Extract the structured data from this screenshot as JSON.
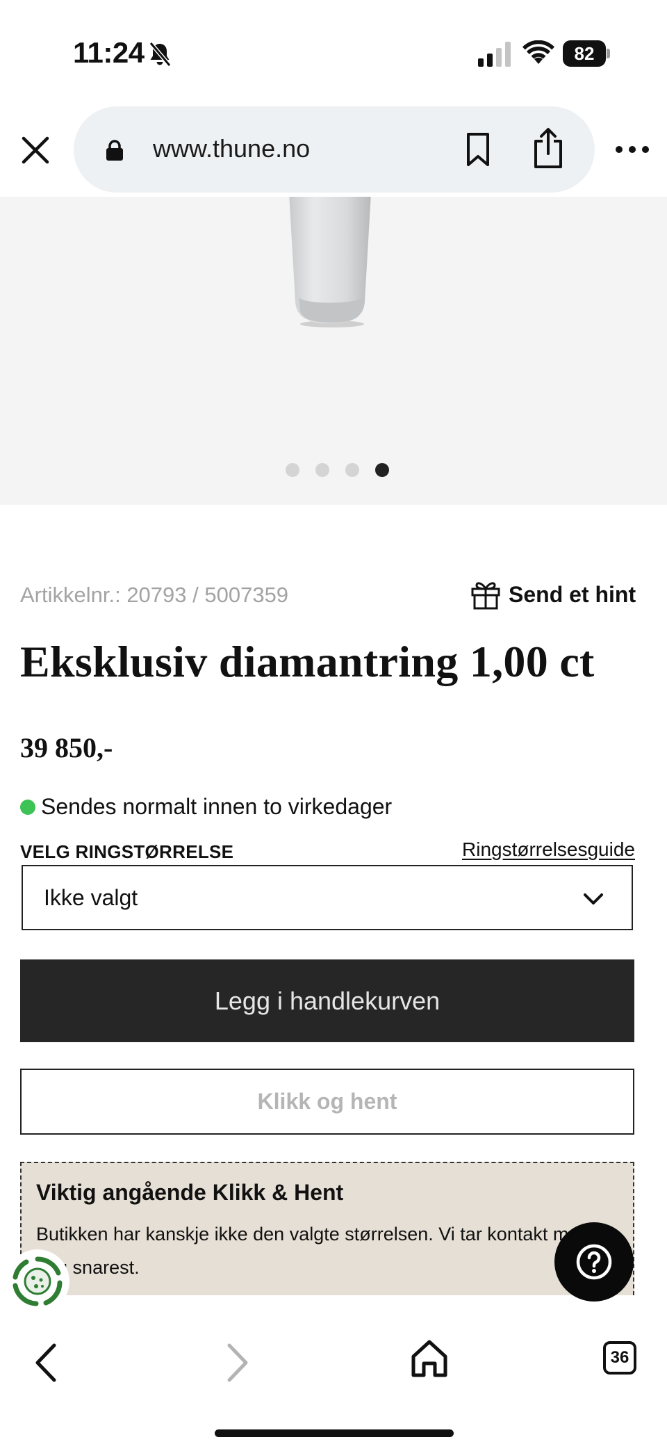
{
  "status_bar": {
    "time": "11:24",
    "battery": "82",
    "icons": [
      "bell-off-icon",
      "cellular-signal-icon",
      "wifi-icon",
      "battery-icon"
    ]
  },
  "browser": {
    "url": "www.thune.no",
    "icons": [
      "close-icon",
      "lock-icon",
      "bookmark-icon",
      "share-icon",
      "more-icon"
    ]
  },
  "gallery": {
    "total_images": 4,
    "active_index": 4
  },
  "product": {
    "article_number": "Artikkelnr.: 20793 / 5007359",
    "hint_label": "Send et hint",
    "title": "Eksklusiv diamantring 1,00 ct",
    "price": "39 850,-",
    "stock_text": "Sendes normalt innen to virkedager",
    "stock_color": "#3cc255"
  },
  "size": {
    "label": "VELG RINGSTØRRELSE",
    "guide_link": "Ringstørrelsesguide",
    "selected": "Ikke valgt"
  },
  "actions": {
    "add_to_cart": "Legg i handlekurven",
    "click_collect": "Klikk og hent"
  },
  "notice": {
    "title": "Viktig angående Klikk & Hent",
    "body": "Butikken har kanskje ikke den valgte størrelsen. Vi tar kontakt med deg snarest.",
    "background": "#e6dfd5"
  },
  "toolbar": {
    "tab_count": "36"
  }
}
